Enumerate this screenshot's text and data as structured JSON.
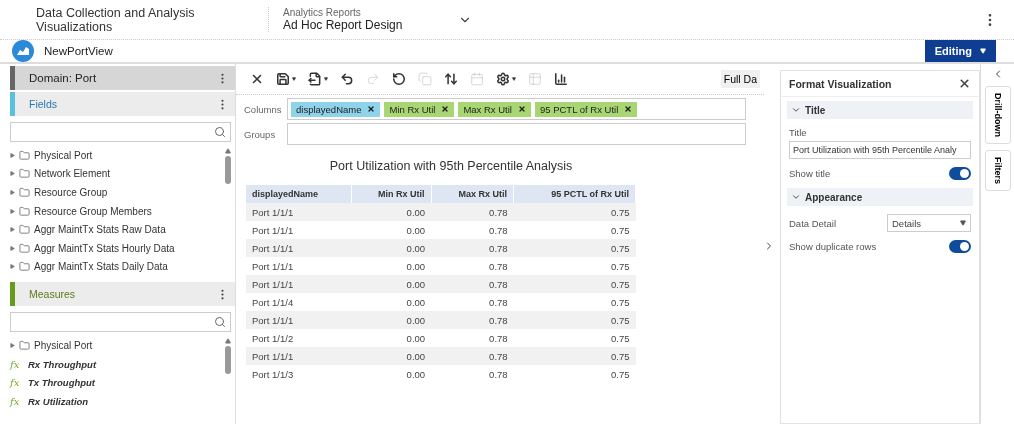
{
  "header": {
    "app_title": "Data Collection and Analysis Visualizations",
    "breadcrumb_label": "Analytics Reports",
    "breadcrumb_value": "Ad Hoc Report Design"
  },
  "view": {
    "name": "NewPortView",
    "mode_button": "Editing"
  },
  "domain_panel": {
    "title": "Domain: Port"
  },
  "fields_section": {
    "title": "Fields",
    "items": [
      {
        "kind": "folder",
        "label": "Physical Port"
      },
      {
        "kind": "folder",
        "label": "Network Element"
      },
      {
        "kind": "folder",
        "label": "Resource Group"
      },
      {
        "kind": "folder",
        "label": "Resource Group Members"
      },
      {
        "kind": "folder",
        "label": "Aggr MaintTx Stats Raw Data"
      },
      {
        "kind": "folder",
        "label": "Aggr MaintTx Stats Hourly Data"
      },
      {
        "kind": "folder",
        "label": "Aggr MaintTx Stats Daily Data"
      }
    ]
  },
  "measures_section": {
    "title": "Measures",
    "items": [
      {
        "kind": "folder",
        "label": "Physical Port"
      },
      {
        "kind": "measure",
        "marker": "fx",
        "label": "Rx Throughput"
      },
      {
        "kind": "measure",
        "marker": "fx",
        "label": "Tx Throughput"
      },
      {
        "kind": "measure",
        "marker": "fx",
        "label": "Rx Utilization"
      }
    ]
  },
  "toolbar": {
    "items": [
      {
        "kind": "close",
        "disabled": false
      },
      {
        "kind": "save",
        "disabled": false
      },
      {
        "kind": "export",
        "disabled": false
      },
      {
        "kind": "undo",
        "disabled": false
      },
      {
        "kind": "redo",
        "disabled": true
      },
      {
        "kind": "revert",
        "disabled": false
      },
      {
        "kind": "copy",
        "disabled": true
      },
      {
        "kind": "sort",
        "disabled": false
      },
      {
        "kind": "calendar",
        "disabled": true
      },
      {
        "kind": "settings",
        "disabled": false
      },
      {
        "kind": "table",
        "disabled": true
      },
      {
        "kind": "chart",
        "disabled": false
      }
    ],
    "data_button": "Full Da"
  },
  "columns_shelf": {
    "label": "Columns",
    "pills": [
      {
        "label": "displayedName",
        "color": "#8fd3ea"
      },
      {
        "label": "Min Rx Util",
        "color": "#a8d672"
      },
      {
        "label": "Max Rx Util",
        "color": "#a8d672"
      },
      {
        "label": "95 PCTL of Rx Util",
        "color": "#a8d672"
      }
    ]
  },
  "groups_shelf": {
    "label": "Groups"
  },
  "report": {
    "title": "Port Utilization with 95th Percentile Analysis",
    "columns": [
      "displayedName",
      "Min Rx Util",
      "Max Rx Util",
      "95 PCTL of Rx Util"
    ],
    "rows": [
      [
        "Port 1/1/1",
        "0.00",
        "0.78",
        "0.75"
      ],
      [
        "Port 1/1/1",
        "0.00",
        "0.78",
        "0.75"
      ],
      [
        "Port 1/1/1",
        "0.00",
        "0.78",
        "0.75"
      ],
      [
        "Port 1/1/1",
        "0.00",
        "0.78",
        "0.75"
      ],
      [
        "Port 1/1/1",
        "0.00",
        "0.78",
        "0.75"
      ],
      [
        "Port 1/1/4",
        "0.00",
        "0.78",
        "0.75"
      ],
      [
        "Port 1/1/1",
        "0.00",
        "0.78",
        "0.75"
      ],
      [
        "Port 1/1/2",
        "0.00",
        "0.78",
        "0.75"
      ],
      [
        "Port 1/1/1",
        "0.00",
        "0.78",
        "0.75"
      ],
      [
        "Port 1/1/3",
        "0.00",
        "0.78",
        "0.75"
      ]
    ]
  },
  "format_panel": {
    "title": "Format Visualization",
    "sections": [
      {
        "title": "Title",
        "expanded": true,
        "fields": [
          {
            "kind": "text",
            "label": "Title",
            "value": "Port Utilization with 95th Percentile Analy"
          },
          {
            "kind": "toggle",
            "label": "Show title",
            "on": true
          }
        ]
      },
      {
        "title": "Appearance",
        "expanded": true,
        "fields": [
          {
            "kind": "select",
            "label": "Data Detail",
            "value": "Details"
          },
          {
            "kind": "toggle",
            "label": "Show duplicate rows",
            "on": true
          }
        ]
      }
    ]
  },
  "side_tabs": [
    "Drill-down",
    "Filters"
  ]
}
